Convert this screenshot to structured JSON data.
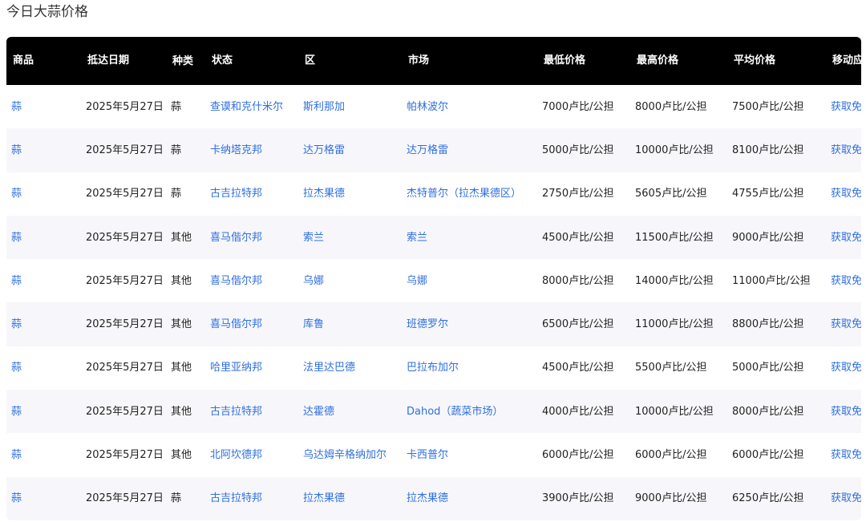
{
  "page": {
    "title": "今日大蒜价格"
  },
  "table": {
    "headers": {
      "commodity": "商品",
      "date": "抵达日期",
      "kind": "种类",
      "state": "状态",
      "district": "区",
      "market": "市场",
      "min": "最低价格",
      "max": "最高价格",
      "avg": "平均价格",
      "app": "移动应用程序"
    },
    "rows": [
      {
        "commodity": "蒜",
        "date": "2025年5月27日",
        "kind": "蒜",
        "state": "查谟和克什米尔",
        "district": "斯利那加",
        "market": "帕林波尔",
        "min": "7000卢比/公担",
        "max": "8000卢比/公担",
        "avg": "7500卢比/公担",
        "app": "获取免费警报"
      },
      {
        "commodity": "蒜",
        "date": "2025年5月27日",
        "kind": "蒜",
        "state": "卡纳塔克邦",
        "district": "达万格雷",
        "market": "达万格雷",
        "min": "5000卢比/公担",
        "max": "10000卢比/公担",
        "avg": "8100卢比/公担",
        "app": "获取免费警报"
      },
      {
        "commodity": "蒜",
        "date": "2025年5月27日",
        "kind": "蒜",
        "state": "古吉拉特邦",
        "district": "拉杰果德",
        "market": "杰特普尔（拉杰果德区）",
        "min": "2750卢比/公担",
        "max": "5605卢比/公担",
        "avg": "4755卢比/公担",
        "app": "获取免费警报"
      },
      {
        "commodity": "蒜",
        "date": "2025年5月27日",
        "kind": "其他",
        "state": "喜马偕尔邦",
        "district": "索兰",
        "market": "索兰",
        "min": "4500卢比/公担",
        "max": "11500卢比/公担",
        "avg": "9000卢比/公担",
        "app": "获取免费警报"
      },
      {
        "commodity": "蒜",
        "date": "2025年5月27日",
        "kind": "其他",
        "state": "喜马偕尔邦",
        "district": "乌娜",
        "market": "乌娜",
        "min": "8000卢比/公担",
        "max": "14000卢比/公担",
        "avg": "11000卢比/公担",
        "app": "获取免费警报"
      },
      {
        "commodity": "蒜",
        "date": "2025年5月27日",
        "kind": "其他",
        "state": "喜马偕尔邦",
        "district": "库鲁",
        "market": "班德罗尔",
        "min": "6500卢比/公担",
        "max": "11000卢比/公担",
        "avg": "8800卢比/公担",
        "app": "获取免费警报"
      },
      {
        "commodity": "蒜",
        "date": "2025年5月27日",
        "kind": "其他",
        "state": "哈里亚纳邦",
        "district": "法里达巴德",
        "market": "巴拉布加尔",
        "min": "4500卢比/公担",
        "max": "5500卢比/公担",
        "avg": "5000卢比/公担",
        "app": "获取免费警报"
      },
      {
        "commodity": "蒜",
        "date": "2025年5月27日",
        "kind": "其他",
        "state": "古吉拉特邦",
        "district": "达霍德",
        "market": "Dahod（蔬菜市场）",
        "min": "4000卢比/公担",
        "max": "10000卢比/公担",
        "avg": "8000卢比/公担",
        "app": "获取免费警报"
      },
      {
        "commodity": "蒜",
        "date": "2025年5月27日",
        "kind": "其他",
        "state": "北阿坎德邦",
        "district": "乌达姆辛格纳加尔",
        "market": "卡西普尔",
        "min": "6000卢比/公担",
        "max": "6000卢比/公担",
        "avg": "6000卢比/公担",
        "app": "获取免费警报"
      },
      {
        "commodity": "蒜",
        "date": "2025年5月27日",
        "kind": "蒜",
        "state": "古吉拉特邦",
        "district": "拉杰果德",
        "market": "拉杰果德",
        "min": "3900卢比/公担",
        "max": "9000卢比/公担",
        "avg": "6250卢比/公担",
        "app": "获取免费警报"
      }
    ]
  }
}
